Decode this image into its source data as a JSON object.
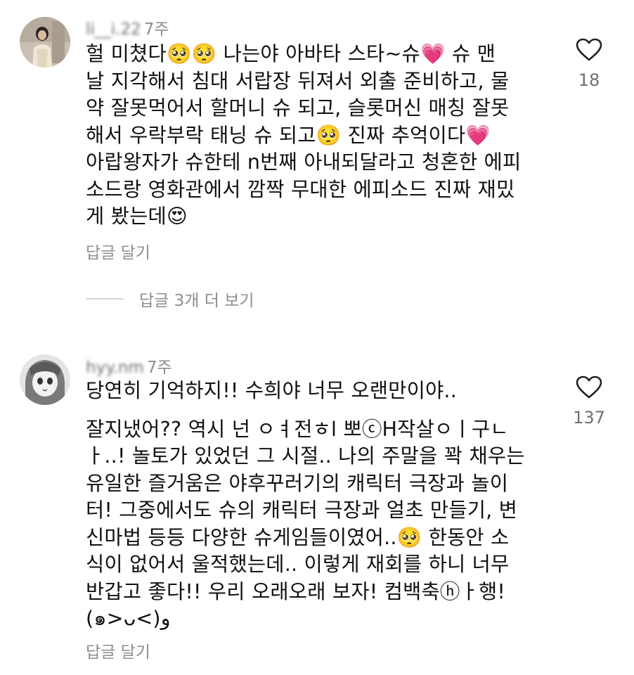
{
  "comments": [
    {
      "username": "li__i.22",
      "time": "7주",
      "lines": [
        "헐 미쳤다🥺🥺 나는야 아바타 스타~슈💗 슈 맨",
        "날 지각해서 침대 서랍장 뒤져서 외출 준비하고, 물",
        "약 잘못먹어서 할머니 슈 되고, 슬롯머신 매칭 잘못",
        "해서 우락부락 태닝 슈 되고🥺 진짜 추억이다💗",
        "아랍왕자가 슈한테 n번째 아내되달라고 청혼한 에피",
        "소드랑 영화관에서 깜짝 무대한 에피소드 진짜 재밌",
        "게 봤는데😍"
      ],
      "reply_label": "답글 달기",
      "like_count": "18",
      "view_replies": "답글 3개 더 보기"
    },
    {
      "username": "hyy.nm",
      "time": "7주",
      "lines": [
        "당연히 기억하지!! 수희야 너무 오랜만이야..",
        "",
        "잘지냈어?? 역시 넌 ㅇㅕ전ㅎl 뽀ⓒH작살ㅇㅣ구ㄴ",
        "ㅏ..! 놀토가 있었던 그 시절.. 나의 주말을 꽉 채우는",
        "유일한 즐거움은 야후꾸러기의 캐릭터 극장과 놀이",
        "터! 그중에서도 슈의 캐릭터 극장과 얼초 만들기, 변",
        "신마법 등등 다양한 슈게임들이였어..🥺 한동안 소",
        "식이 없어서 울적했는데.. 이렇게 재회를 하니 너무",
        "반갑고 좋다!! 우리 오래오래 보자! 컴백축ⓗㅏ행!",
        "(๑>ᴗ<)و"
      ],
      "reply_label": "답글 달기",
      "like_count": "137"
    }
  ],
  "icons": {
    "like": "heart-outline-icon"
  },
  "colors": {
    "text": "#111111",
    "muted": "#8e8e8e",
    "rule": "#d6d6d6"
  }
}
